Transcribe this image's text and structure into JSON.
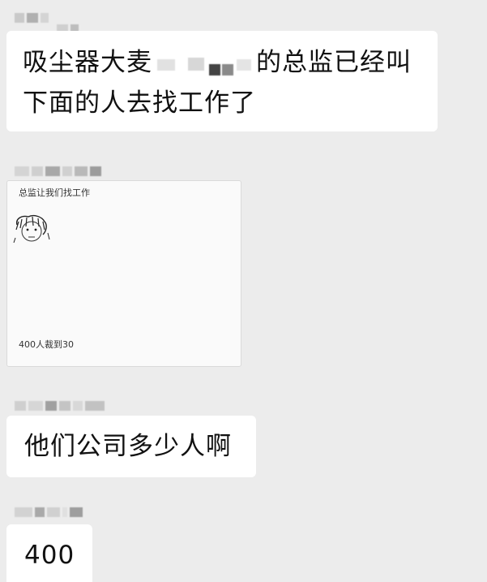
{
  "chat": {
    "messages": [
      {
        "text_before": "吸尘器大麦",
        "text_after": "的总监已经叫",
        "text_line2": "下面的人去找工作了"
      },
      {
        "card_title": "总监让我们找工作",
        "card_caption": "400人裁到30"
      },
      {
        "text": "他们公司多少人啊"
      },
      {
        "text": "400"
      }
    ]
  }
}
